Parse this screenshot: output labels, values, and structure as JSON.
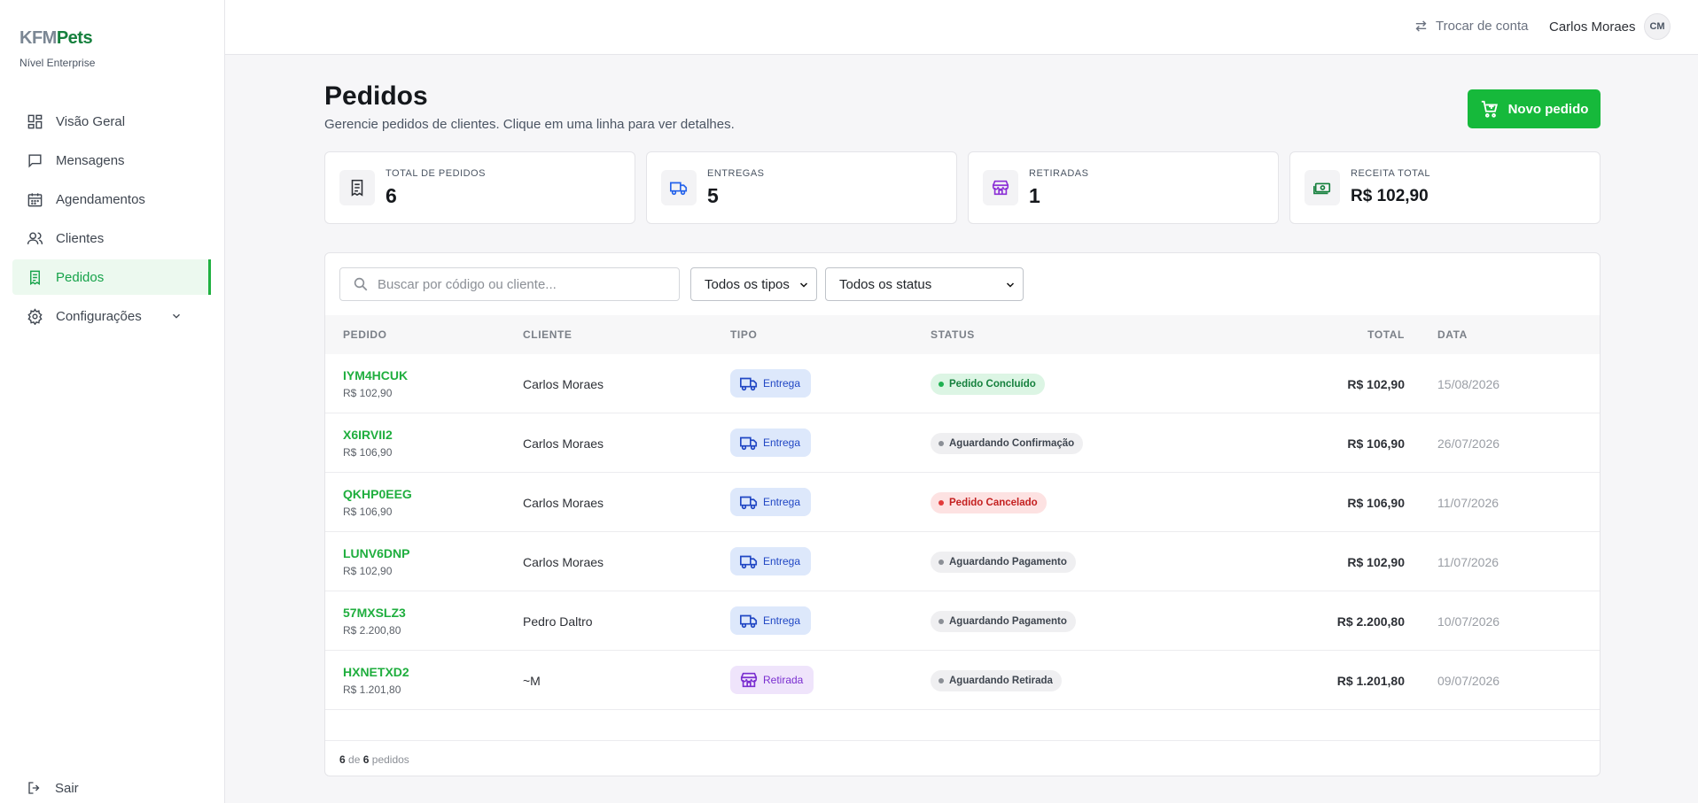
{
  "brand": {
    "part1": "KFM",
    "part2": "Pets",
    "tier": "Nível Enterprise"
  },
  "sidebar": {
    "items": [
      {
        "label": "Visão Geral",
        "icon": "dashboard-icon"
      },
      {
        "label": "Mensagens",
        "icon": "chat-icon"
      },
      {
        "label": "Agendamentos",
        "icon": "calendar-icon"
      },
      {
        "label": "Clientes",
        "icon": "users-icon"
      },
      {
        "label": "Pedidos",
        "icon": "receipt-icon",
        "active": true
      },
      {
        "label": "Configurações",
        "icon": "gear-icon",
        "expandable": true
      }
    ],
    "logout": "Sair"
  },
  "topbar": {
    "switch_account": "Trocar de conta",
    "user_name": "Carlos Moraes",
    "avatar_initials": "CM"
  },
  "header": {
    "title": "Pedidos",
    "subtitle": "Gerencie pedidos de clientes. Clique em uma linha para ver detalhes.",
    "new_order": "Novo pedido"
  },
  "stats": [
    {
      "label": "TOTAL DE PEDIDOS",
      "value": "6",
      "icon": "receipt-icon"
    },
    {
      "label": "ENTREGAS",
      "value": "5",
      "icon": "truck-icon"
    },
    {
      "label": "RETIRADAS",
      "value": "1",
      "icon": "store-icon"
    },
    {
      "label": "RECEITA TOTAL",
      "value": "R$ 102,90",
      "icon": "money-icon"
    }
  ],
  "filters": {
    "search_placeholder": "Buscar por código ou cliente...",
    "type_selected": "Todos os tipos",
    "status_selected": "Todos os status"
  },
  "table": {
    "columns": [
      "PEDIDO",
      "CLIENTE",
      "TIPO",
      "STATUS",
      "TOTAL",
      "DATA"
    ],
    "rows": [
      {
        "code": "IYM4HCUK",
        "amount": "R$ 102,90",
        "client": "Carlos Moraes",
        "type": "Entrega",
        "type_kind": "delivery",
        "status": "Pedido Concluído",
        "status_kind": "done",
        "total": "R$ 102,90",
        "date": "15/08/2026"
      },
      {
        "code": "X6IRVII2",
        "amount": "R$ 106,90",
        "client": "Carlos Moraes",
        "type": "Entrega",
        "type_kind": "delivery",
        "status": "Aguardando Confirmação",
        "status_kind": "wait",
        "total": "R$ 106,90",
        "date": "26/07/2026"
      },
      {
        "code": "QKHP0EEG",
        "amount": "R$ 106,90",
        "client": "Carlos Moraes",
        "type": "Entrega",
        "type_kind": "delivery",
        "status": "Pedido Cancelado",
        "status_kind": "cancel",
        "total": "R$ 106,90",
        "date": "11/07/2026"
      },
      {
        "code": "LUNV6DNP",
        "amount": "R$ 102,90",
        "client": "Carlos Moraes",
        "type": "Entrega",
        "type_kind": "delivery",
        "status": "Aguardando Pagamento",
        "status_kind": "wait",
        "total": "R$ 102,90",
        "date": "11/07/2026"
      },
      {
        "code": "57MXSLZ3",
        "amount": "R$ 2.200,80",
        "client": "Pedro Daltro",
        "type": "Entrega",
        "type_kind": "delivery",
        "status": "Aguardando Pagamento",
        "status_kind": "wait",
        "total": "R$ 2.200,80",
        "date": "10/07/2026"
      },
      {
        "code": "HXNETXD2",
        "amount": "R$ 1.201,80",
        "client": "~M",
        "type": "Retirada",
        "type_kind": "pickup",
        "status": "Aguardando Retirada",
        "status_kind": "wait",
        "total": "R$ 1.201,80",
        "date": "09/07/2026"
      }
    ]
  },
  "footer": {
    "shown": "6",
    "of": "de",
    "total": "6",
    "unit": "pedidos"
  },
  "colors": {
    "accent": "#16b93b",
    "delivery_bg": "#dde8fb",
    "pickup_bg": "#efe4fb",
    "done": "#15803d",
    "cancel": "#c42020"
  }
}
